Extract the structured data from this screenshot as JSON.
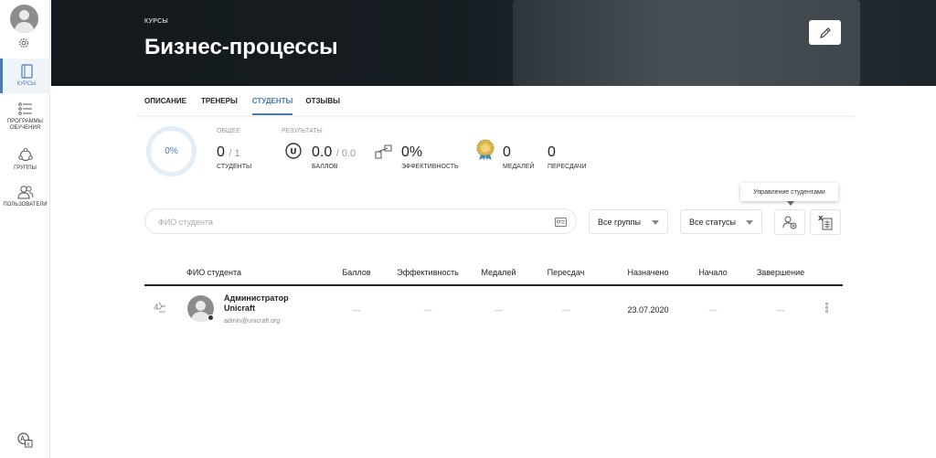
{
  "sidebar": {
    "items": [
      {
        "label": "Курсы",
        "icon": "book-icon",
        "active": true
      },
      {
        "label": "Программы обучения",
        "icon": "list-icon",
        "active": false
      },
      {
        "label": "Группы",
        "icon": "group-icon",
        "active": false
      },
      {
        "label": "Пользователи",
        "icon": "users-icon",
        "active": false
      }
    ]
  },
  "banner": {
    "category": "Курсы",
    "title": "Бизнес-процессы"
  },
  "tabs": [
    {
      "label": "Описание",
      "active": false
    },
    {
      "label": "Тренеры",
      "active": false
    },
    {
      "label": "Студенты",
      "active": true
    },
    {
      "label": "Отзывы",
      "active": false
    }
  ],
  "stats": {
    "progress": "0%",
    "overall_caption": "Общее",
    "students_value": "0",
    "students_total": "/ 1",
    "students_label": "Студенты",
    "results_caption": "Результаты",
    "score_value": "0.0",
    "score_total": "/ 0.0",
    "score_label": "Баллов",
    "efficiency_value": "0%",
    "efficiency_label": "Эффективность",
    "medals_value": "0",
    "medals_label": "Медалей",
    "retakes_value": "0",
    "retakes_label": "Пересдачи"
  },
  "filters": {
    "search_placeholder": "ФИО студента",
    "groups_select": "Все группы",
    "status_select": "Все статусы",
    "tooltip": "Управление студентами"
  },
  "table": {
    "headers": [
      "ФИО студента",
      "Баллов",
      "Эффективность",
      "Медалей",
      "Пересдач",
      "Назначено",
      "Начало",
      "Завершение"
    ],
    "rows": [
      {
        "name": "Администратор Unicraft",
        "email": "admin@unicraft.org",
        "score": "—",
        "efficiency": "—",
        "medals": "—",
        "retakes": "—",
        "assigned": "23.07.2020",
        "start": "—",
        "end": "—"
      }
    ]
  },
  "colors": {
    "accent": "#4a7ab4",
    "banner": "#1c2429"
  }
}
